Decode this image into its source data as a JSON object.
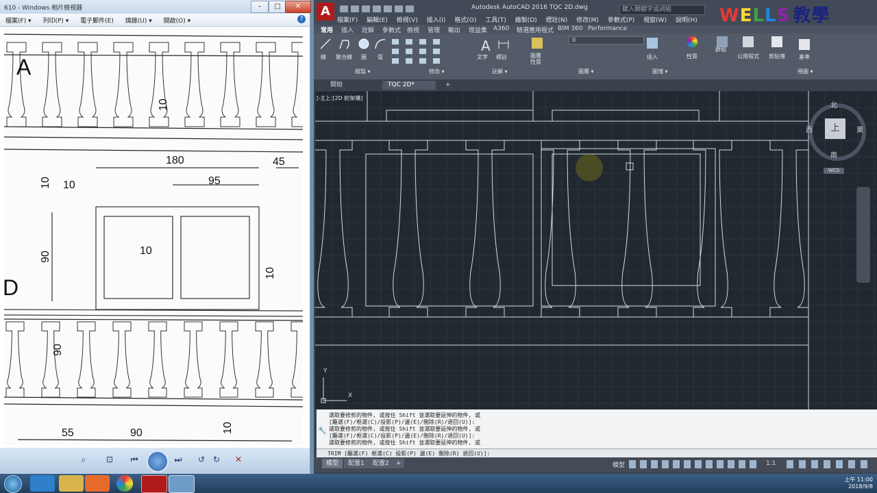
{
  "viewer": {
    "title": "610 - Windows 相片檢視器",
    "menu": [
      "檔案(F) ▾",
      "列印(P) ▾",
      "電子郵件(E)",
      "燒錄(U) ▾",
      "開啟(O) ▾"
    ],
    "dims": [
      "A",
      "10",
      "180",
      "45",
      "10",
      "10",
      "95",
      "90",
      "10",
      "10",
      "D",
      "90",
      "55",
      "90",
      "10"
    ]
  },
  "acad": {
    "title": "Autodesk AutoCAD 2016    TQC 2D.dwg",
    "search_placeholder": "鍵入關鍵字或詞組",
    "wells": "WELLS教學",
    "menu": [
      "檔案(F)",
      "編輯(E)",
      "檢視(V)",
      "插入(I)",
      "格式(O)",
      "工具(T)",
      "繪製(D)",
      "標註(N)",
      "修改(M)",
      "參數式(P)",
      "視窗(W)",
      "說明(H)"
    ],
    "tabs": [
      "常用",
      "插入",
      "註解",
      "參數式",
      "檢視",
      "管理",
      "輸出",
      "增益集",
      "A360",
      "精選應用程式",
      "BIM 360",
      "Performance"
    ],
    "ribbon_labels": {
      "line": "線",
      "polyline": "聚合線",
      "circle": "圓",
      "arc": "弧",
      "text": "文字",
      "dimension": "標註",
      "layer_props": "圖層\n性質",
      "insert": "插入",
      "properties": "性質",
      "group": "群組",
      "utilities": "公用程式",
      "clipboard": "剪貼簿",
      "base": "基準",
      "layer_value": "0"
    },
    "panels": [
      "繪製 ▾",
      "修改 ▾",
      "註解 ▾",
      "圖層 ▾",
      "圖塊 ▾",
      "視圖 ▾"
    ],
    "doc_tabs": [
      "開始",
      "TQC 2D*"
    ],
    "viewport_label": "[-][上][2D 線架構]",
    "viewcube": {
      "top": "上",
      "north": "北",
      "south": "南",
      "east": "東",
      "west": "西",
      "wcs": "WCS"
    },
    "ucs": {
      "x": "X",
      "y": "Y"
    },
    "history": [
      "選取要修剪的物件, 或按住 Shift 並選取要延伸的物件, 或",
      "[籬選(F)/框選(C)/投影(P)/邊(E)/刪除(R)/退回(U)]:",
      "選取要修剪的物件, 或按住 Shift 並選取要延伸的物件, 或",
      "[籬選(F)/框選(C)/投影(P)/邊(E)/刪除(R)/退回(U)]:",
      "選取要修剪的物件, 或按住 Shift 並選取要延伸的物件, 或"
    ],
    "command": "TRIM [籬選(F) 框選(C) 投影(P) 邊(E) 刪除(R) 退回(U)]:",
    "layout_tabs": [
      "模型",
      "配置1",
      "配置2"
    ],
    "status": {
      "model": "模型",
      "scale": "1:1"
    }
  },
  "taskbar": {
    "time": "上午 11:00",
    "date": "2018/9/8"
  },
  "colors": {
    "canvas": "#212830",
    "line": "#d6dbe1",
    "accent": "#b11a1a"
  }
}
